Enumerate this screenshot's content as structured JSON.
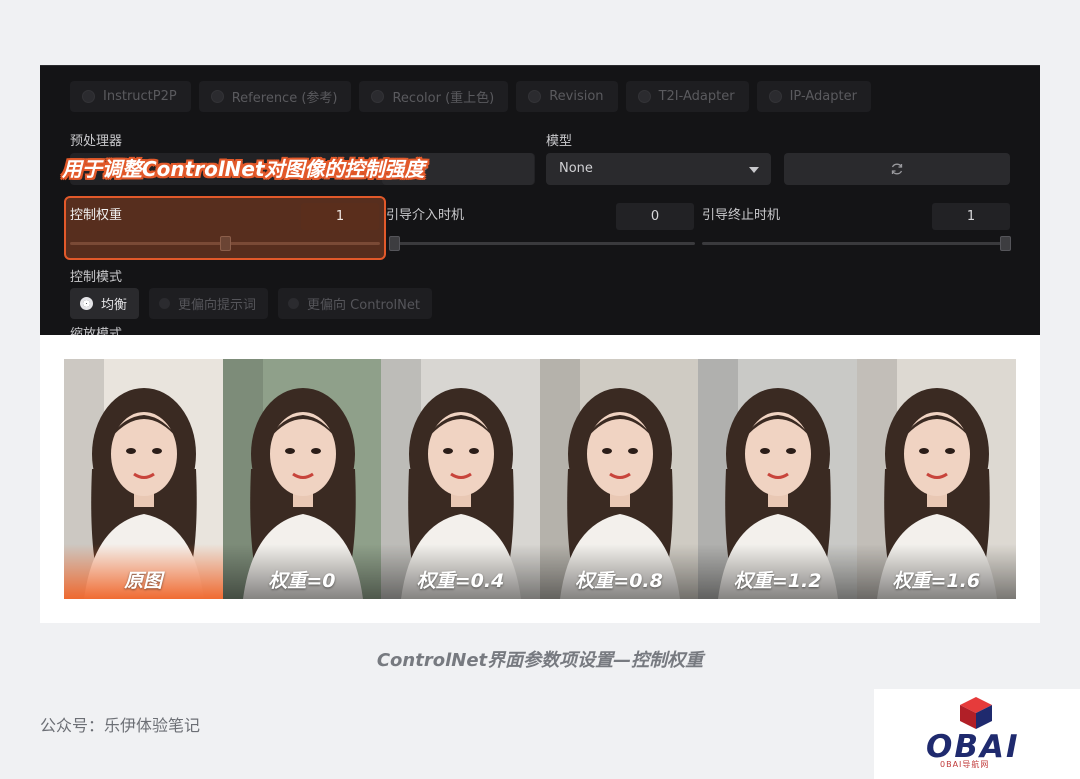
{
  "ui": {
    "preprocessor_types": [
      "InstructP2P",
      "Reference (参考)",
      "Recolor (重上色)",
      "Revision",
      "T2I-Adapter",
      "IP-Adapter"
    ],
    "preprocessor_label": "预处理器",
    "model_label": "模型",
    "model_value": "None",
    "weight_label": "控制权重",
    "weight_value": "1",
    "weight_fraction": 0.5,
    "start_label": "引导介入时机",
    "start_value": "0",
    "start_fraction": 0,
    "end_label": "引导终止时机",
    "end_value": "1",
    "end_fraction": 1,
    "control_mode_label": "控制模式",
    "control_modes": [
      "均衡",
      "更偏向提示词",
      "更偏向 ControlNet"
    ],
    "selected_mode": "均衡",
    "resize_mode_label": "缩放模式"
  },
  "annotation": "用于调整ControlNet对图像的控制强度",
  "photos": [
    {
      "caption": "原图",
      "bg": "#e9e4dd"
    },
    {
      "caption": "权重=0",
      "bg": "#8fa08a"
    },
    {
      "caption": "权重=0.4",
      "bg": "#d8d6d2"
    },
    {
      "caption": "权重=0.8",
      "bg": "#cfcbc3"
    },
    {
      "caption": "权重=1.2",
      "bg": "#c9c9c6"
    },
    {
      "caption": "权重=1.6",
      "bg": "#ddd9d2"
    }
  ],
  "figure_caption": "ControlNet界面参数项设置—控制权重",
  "footer": "公众号：乐伊体验笔记",
  "logo": {
    "word": "OBAI",
    "sub": "0BAI导航网"
  },
  "colors": {
    "accent": "#e2592a",
    "dark_panel": "#141416",
    "logo_blue": "#1f2a6e",
    "logo_red": "#d7262f"
  }
}
